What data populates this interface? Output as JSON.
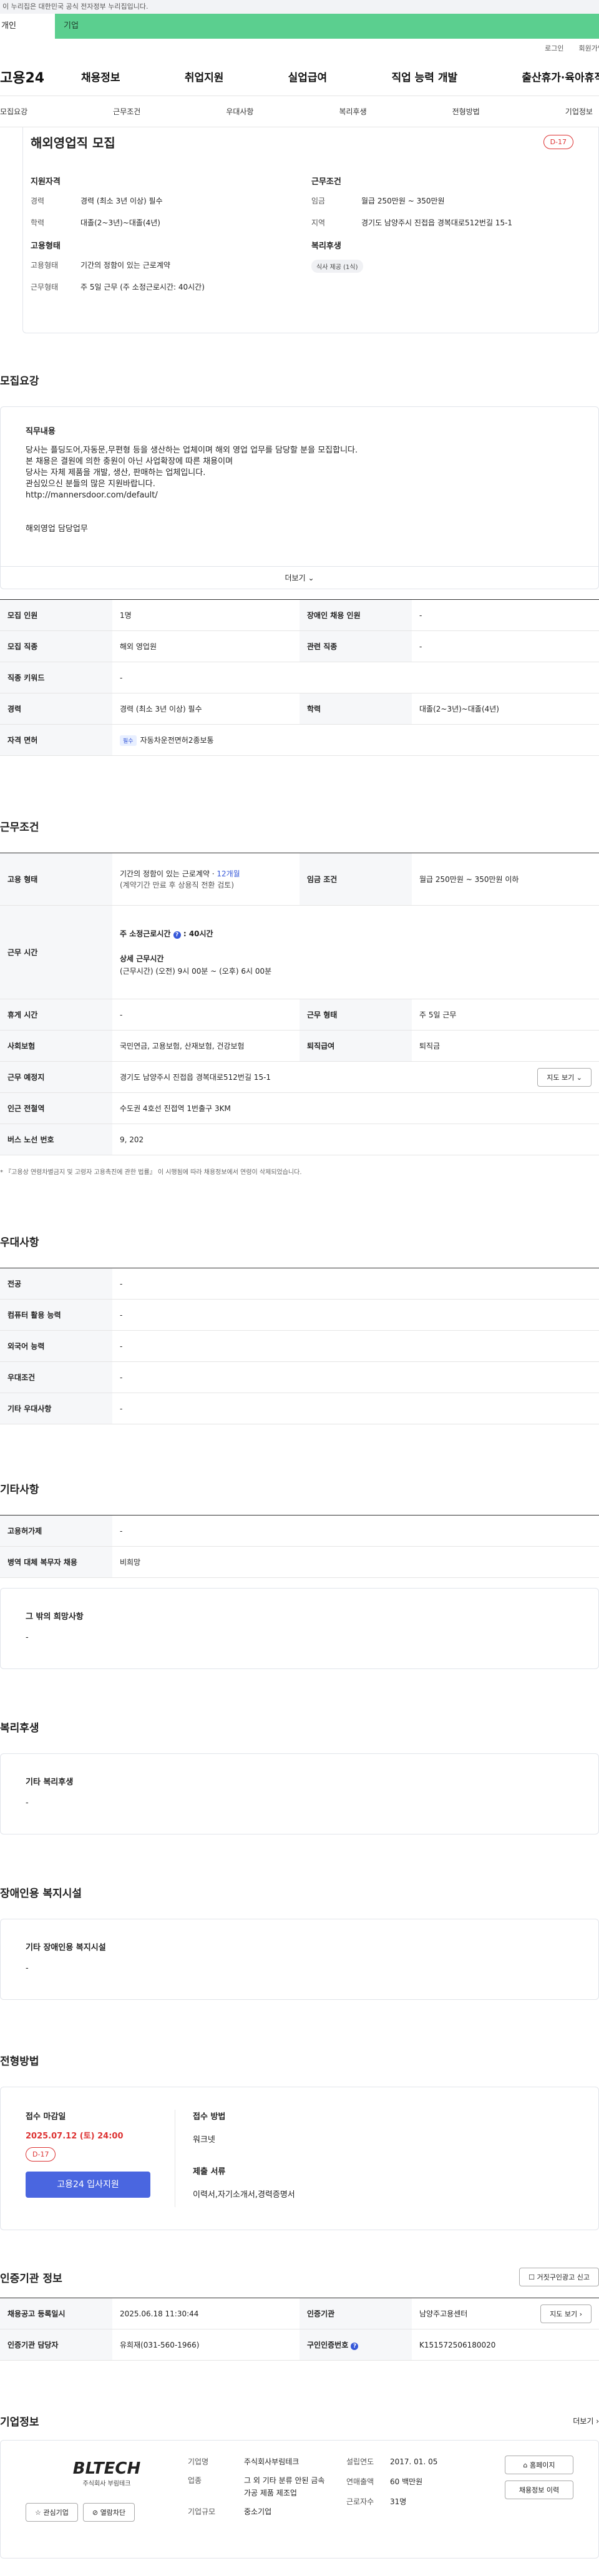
{
  "gov": {
    "notice": "이 누리집은 대한민국 공식 전자정부 누리집입니다."
  },
  "login_tabs": {
    "personal": "개인",
    "company": "기업"
  },
  "util": {
    "login": "로그인",
    "join": "회원가입"
  },
  "gnb": {
    "logo": "고용24",
    "menu": [
      "채용정보",
      "취업지원",
      "실업급여",
      "직업 능력 개발",
      "출산휴가·육아휴직"
    ]
  },
  "subtabs": [
    "모집요강",
    "근무조건",
    "우대사항",
    "복리후생",
    "전형방법",
    "기업정보"
  ],
  "summary": {
    "title": "해외영업직 모집",
    "dday": "D-17",
    "left": [
      {
        "heading": "지원자격",
        "rows": [
          {
            "k": "경력",
            "v": "경력 (최소 3년 이상) 필수"
          },
          {
            "k": "학력",
            "v": "대졸(2~3년)~대졸(4년)"
          }
        ]
      },
      {
        "heading": "고용형태",
        "rows": [
          {
            "k": "고용형태",
            "v": "기간의 정함이 있는 근로계약"
          },
          {
            "k": "근무형태",
            "v": "주 5일 근무 (주 소정근로시간: 40시간)"
          }
        ]
      }
    ],
    "right": [
      {
        "heading": "근무조건",
        "rows": [
          {
            "k": "임금",
            "v": "월급 250만원 ~ 350만원"
          },
          {
            "k": "지역",
            "v": "경기도 남양주시 진접읍 경복대로512번길 15-1"
          }
        ]
      },
      {
        "heading": "복리후생",
        "chip": "식사 제공 (1식)"
      }
    ]
  },
  "recruit": {
    "title": "모집요강",
    "desc_heading": "직무내용",
    "desc_text": "당사는 플딩도어,자동문,무편형 등을 생산하는 업체이며 해외 영업 업무를 담당할 분을 모집합니다.\n본 채용은 결원에 의한 충원이 아닌 사업확장에 따른 채용이며\n당사는 자체 제품을 개발, 생산, 판매하는 업체입니다.\n관심있으신 분들의 많은 지원바랍니다.\nhttp://mannersdoor.com/default/\n\n\n해외영업 담당업무",
    "more": "더보기",
    "rows": [
      [
        "모집 인원",
        "1명",
        "장애인 채용 인원",
        "-"
      ],
      [
        "모집 직종",
        "해외 영업원",
        "관련 직종",
        "-"
      ],
      [
        "직종 키워드",
        "-"
      ],
      [
        "경력",
        "경력 (최소 3년 이상) 필수",
        "학력",
        "대졸(2~3년)~대졸(4년)"
      ]
    ],
    "license_label": "자격 면허",
    "license_badge": "필수",
    "license_value": "자동차운전면허2종보통"
  },
  "work": {
    "title": "근무조건",
    "employ_label": "고용 형태",
    "employ_value": "기간의 정함이 있는 근로계약 · ",
    "employ_months": "12개월",
    "employ_note": "(계약기간 만료 후 상용직 전환 검토)",
    "wage_label": "임금 조건",
    "wage_value": "월급 250만원 ~ 350만원 이하",
    "hours_label": "근무 시간",
    "hours_week_label": "주 소정근로시간",
    "hours_week_value": ": 40시간",
    "hours_detail_label": "상세 근무시간",
    "hours_detail_value": "(근무시간) (오전) 9시 00분 ~ (오후) 6시 00분",
    "rows": [
      [
        "휴게 시간",
        "-",
        "근무 형태",
        "주 5일 근무"
      ],
      [
        "사회보험",
        "국민연금, 고용보험, 산재보험, 건강보험",
        "퇴직급여",
        "퇴직금"
      ]
    ],
    "place_label": "근무 예정지",
    "place_value": "경기도 남양주시 진접읍 경복대로512번길 15-1",
    "map_btn": "지도 보기",
    "station_label": "인근 전철역",
    "station_value": "수도권 4호선 진접역 1번출구 3KM",
    "bus_label": "버스 노선 번호",
    "bus_value": "9, 202",
    "note": "* 『고용상 연령차별금지 및 고령자 고용촉진에 관한 법률』 이 시행됨에 따라 채용정보에서 연령이 삭제되었습니다."
  },
  "prefer": {
    "title": "우대사항",
    "rows": [
      [
        "전공",
        "-"
      ],
      [
        "컴퓨터 활용 능력",
        "-"
      ],
      [
        "외국어 능력",
        "-"
      ],
      [
        "우대조건",
        "-"
      ],
      [
        "기타 우대사항",
        "-"
      ]
    ]
  },
  "etc": {
    "title": "기타사항",
    "rows": [
      [
        "고용허가제",
        "-"
      ],
      [
        "병역 대체 복무자 채용",
        "비희망"
      ]
    ],
    "box_heading": "그 밖의 희망사항",
    "box_value": "-"
  },
  "welfare": {
    "title": "복리후생",
    "box_heading": "기타 복리후생",
    "box_value": "-"
  },
  "disabled": {
    "title": "장애인용 복지시설",
    "box_heading": "기타 장애인용 복지시설",
    "box_value": "-"
  },
  "apply": {
    "title": "전형방법",
    "deadline_label": "접수 마감일",
    "deadline_value": "2025.07.12 (토) 24:00",
    "dday": "D-17",
    "apply_btn": "고용24 입사지원",
    "method_label": "접수 방법",
    "method_value": "워크넷",
    "docs_label": "제출 서류",
    "docs_value": "이력서,자기소개서,경력증명서"
  },
  "agency": {
    "title": "인증기관 정보",
    "report_btn": "거짓구인광고 신고",
    "rows": [
      [
        "채용공고 등록일시",
        "2025.06.18 11:30:44",
        "인증기관",
        "남양주고용센터"
      ],
      [
        "인증기관 담당자",
        "유희재(031-560-1966)",
        "구인인증번호",
        "K151572506180020"
      ]
    ],
    "map_btn": "지도 보기"
  },
  "company": {
    "title": "기업정보",
    "more": "더보기",
    "logo_text": "BLTECH",
    "logo_sub": "주식회사 부림테크",
    "interest_btn": "관심기업",
    "block_btn": "열람차단",
    "fields": [
      [
        "기업명",
        "주식회사부림테크"
      ],
      [
        "업종",
        "그 외 기타 분류 안된 금속 가공 제품 제조업"
      ],
      [
        "기업규모",
        "중소기업"
      ]
    ],
    "fields2": [
      [
        "설립연도",
        "2017. 01. 05"
      ],
      [
        "연매출액",
        "60 백만원"
      ],
      [
        "근로자수",
        "31명"
      ]
    ],
    "home_btn": "홈페이지",
    "jobs_btn": "채용정보 이력"
  }
}
